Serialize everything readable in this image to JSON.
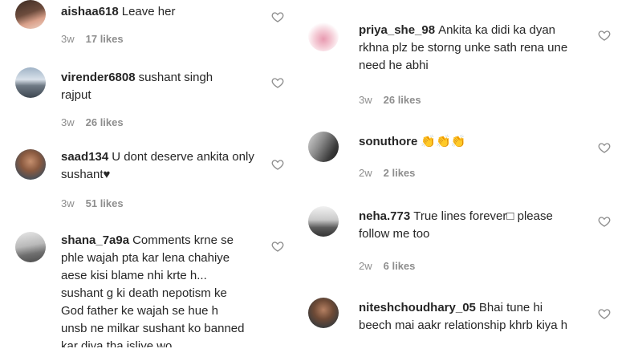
{
  "colors": {
    "text": "#262626",
    "muted": "#8e8e8e",
    "heart_stroke": "#8e8e8e"
  },
  "left_comments": [
    {
      "username": "aishaa618",
      "text": "Leave her",
      "age": "3w",
      "likes": "17 likes"
    },
    {
      "username": "virender6808",
      "text": "sushant singh rajput",
      "age": "3w",
      "likes": "26 likes"
    },
    {
      "username": "saad134",
      "text": "U dont deserve ankita only sushant♥",
      "age": "3w",
      "likes": "51 likes"
    },
    {
      "username": "shana_7a9a",
      "text": "Comments krne se phle wajah pta kar lena chahiye aese kisi blame nhi krte h... sushant g ki death nepotism ke God father ke wajah se hue h unsb ne milkar sushant ko banned kar diya tha isliye wo"
    }
  ],
  "right_comments": [
    {
      "username": "priya_she_98",
      "text": "Ankita ka didi ka dyan rkhna plz be storng unke sath rena une need he abhi",
      "age": "3w",
      "likes": "26 likes"
    },
    {
      "username": "sonuthore",
      "text": "👏👏👏",
      "age": "2w",
      "likes": "2 likes"
    },
    {
      "username": "neha.773",
      "text": "True lines forever□ please follow me too",
      "age": "2w",
      "likes": "6 likes"
    },
    {
      "username": "niteshchoudhary_05",
      "text": "Bhai tune hi beech mai aakr relationship khrb kiya h"
    }
  ]
}
